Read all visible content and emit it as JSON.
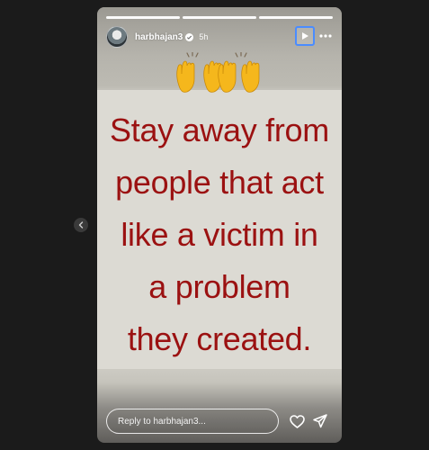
{
  "story": {
    "username": "harbhajan3",
    "time_ago": "5h",
    "segments": 3,
    "emoji": "🙌🙌🙌",
    "quote_lines": [
      "Stay away from",
      "people that act",
      "like a victim in",
      "a problem",
      "they created."
    ]
  },
  "reply": {
    "placeholder": "Reply to harbhajan3..."
  },
  "icons": {
    "prev": "chevron-left-icon",
    "verified": "verified-badge-icon",
    "play": "play-icon",
    "more": "more-horizontal-icon",
    "like": "heart-icon",
    "share": "paper-plane-icon"
  },
  "colors": {
    "background": "#1b1b1b",
    "quote_text": "#9b1111",
    "focus_outline": "#4a8cff"
  }
}
